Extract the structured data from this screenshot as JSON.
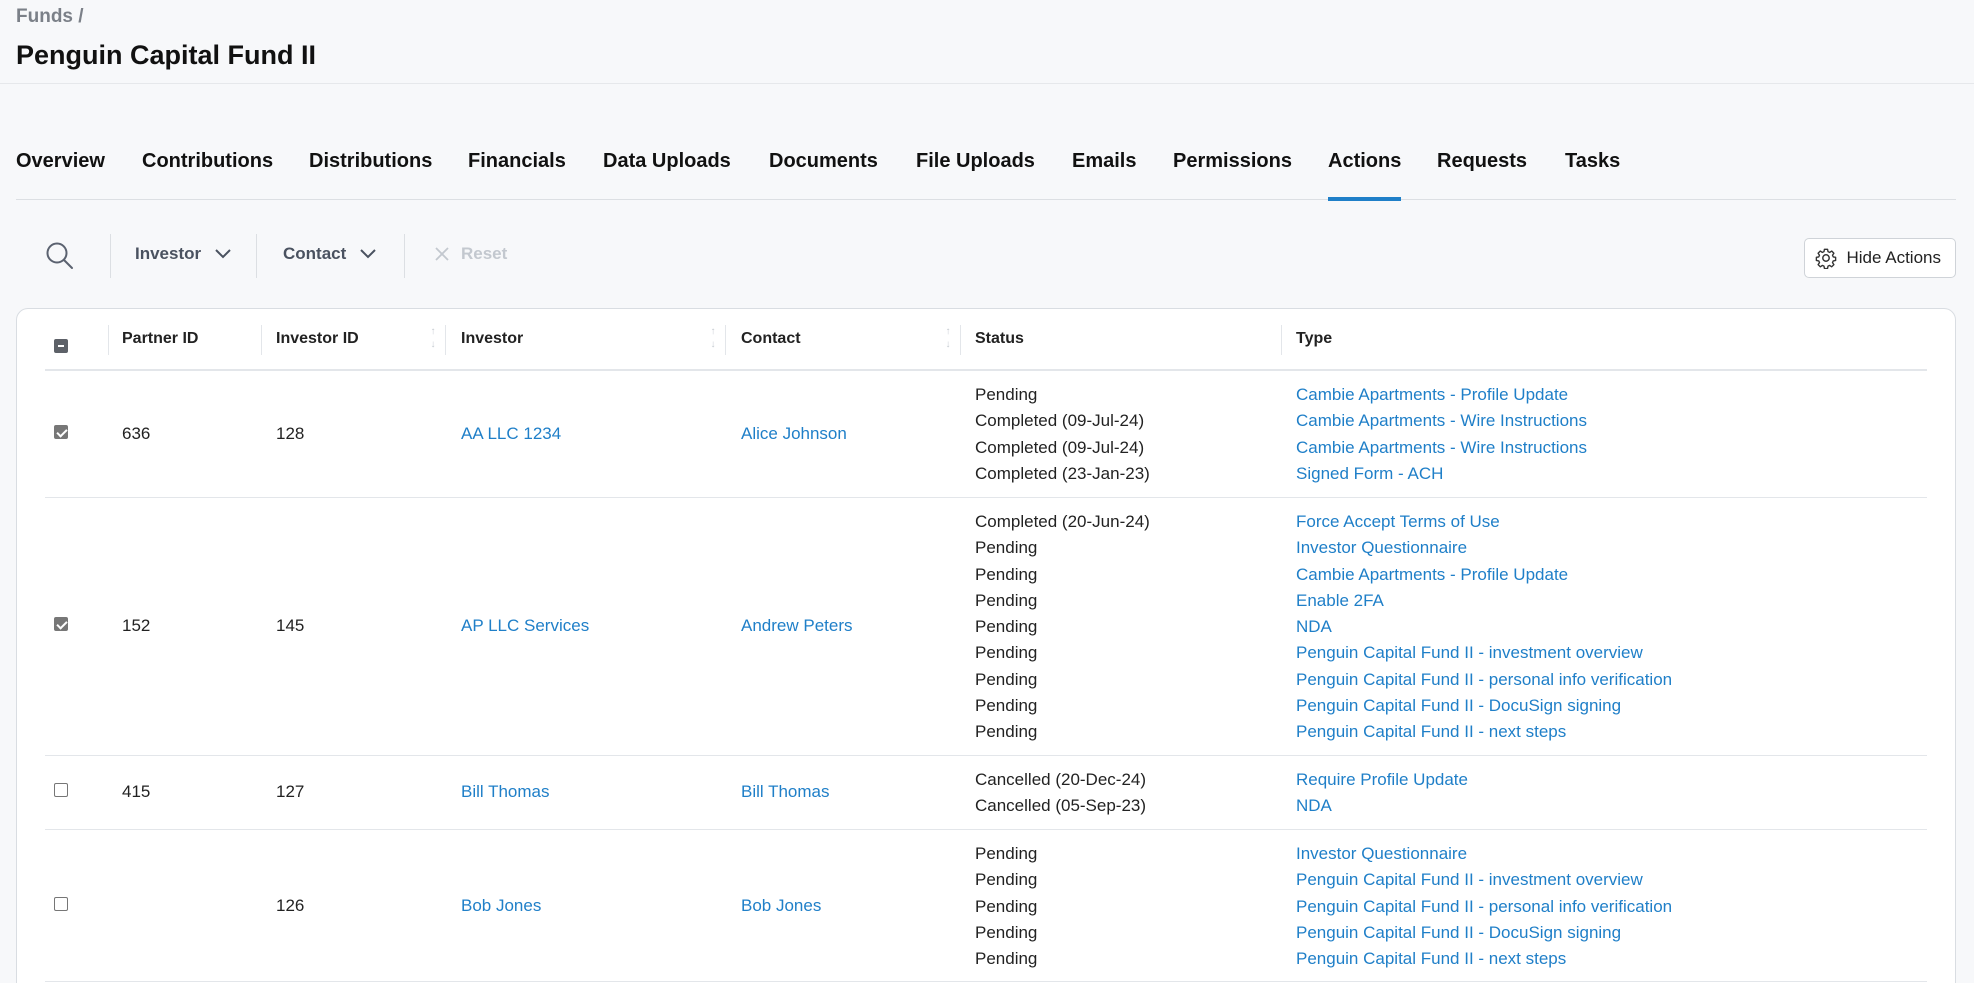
{
  "breadcrumb": "Funds /",
  "page_title": "Penguin Capital Fund II",
  "tabs": [
    {
      "label": "Overview"
    },
    {
      "label": "Contributions"
    },
    {
      "label": "Distributions"
    },
    {
      "label": "Financials"
    },
    {
      "label": "Data Uploads"
    },
    {
      "label": "Documents"
    },
    {
      "label": "File Uploads"
    },
    {
      "label": "Emails"
    },
    {
      "label": "Permissions"
    },
    {
      "label": "Actions"
    },
    {
      "label": "Requests"
    },
    {
      "label": "Tasks"
    }
  ],
  "active_tab": "Actions",
  "toolbar": {
    "icons": {
      "search": "search-icon",
      "chevron": "chevron-down-icon",
      "reset": "close-icon",
      "settings": "gear-icon"
    },
    "investor_filter": "Investor",
    "contact_filter": "Contact",
    "reset_label": "Reset",
    "hide_actions_label": "Hide Actions"
  },
  "table": {
    "headers": {
      "partner_id": "Partner ID",
      "investor_id": "Investor ID",
      "investor": "Investor",
      "contact": "Contact",
      "status": "Status",
      "type": "Type"
    },
    "select_all_state": "indeterminate",
    "rows": [
      {
        "checked": true,
        "partner_id": "636",
        "investor_id": "128",
        "investor": "AA LLC 1234",
        "contact": "Alice Johnson",
        "actions": [
          {
            "status": "Pending",
            "type": "Cambie Apartments - Profile Update"
          },
          {
            "status": "Completed (09-Jul-24)",
            "type": "Cambie Apartments - Wire Instructions"
          },
          {
            "status": "Completed (09-Jul-24)",
            "type": "Cambie Apartments - Wire Instructions"
          },
          {
            "status": "Completed (23-Jan-23)",
            "type": "Signed Form - ACH"
          }
        ]
      },
      {
        "checked": true,
        "partner_id": "152",
        "investor_id": "145",
        "investor": "AP LLC Services",
        "contact": "Andrew Peters",
        "actions": [
          {
            "status": "Completed (20-Jun-24)",
            "type": "Force Accept Terms of Use"
          },
          {
            "status": "Pending",
            "type": "Investor Questionnaire"
          },
          {
            "status": "Pending",
            "type": "Cambie Apartments - Profile Update"
          },
          {
            "status": "Pending",
            "type": "Enable 2FA"
          },
          {
            "status": "Pending",
            "type": "NDA"
          },
          {
            "status": "Pending",
            "type": "Penguin Capital Fund II - investment overview"
          },
          {
            "status": "Pending",
            "type": "Penguin Capital Fund II - personal info verification"
          },
          {
            "status": "Pending",
            "type": "Penguin Capital Fund II - DocuSign signing"
          },
          {
            "status": "Pending",
            "type": "Penguin Capital Fund II - next steps"
          }
        ]
      },
      {
        "checked": false,
        "partner_id": "415",
        "investor_id": "127",
        "investor": "Bill Thomas",
        "contact": "Bill Thomas",
        "actions": [
          {
            "status": "Cancelled (20-Dec-24)",
            "type": "Require Profile Update"
          },
          {
            "status": "Cancelled (05-Sep-23)",
            "type": "NDA"
          }
        ]
      },
      {
        "checked": false,
        "partner_id": "",
        "investor_id": "126",
        "investor": "Bob Jones",
        "contact": "Bob Jones",
        "actions": [
          {
            "status": "Pending",
            "type": "Investor Questionnaire"
          },
          {
            "status": "Pending",
            "type": "Penguin Capital Fund II - investment overview"
          },
          {
            "status": "Pending",
            "type": "Penguin Capital Fund II - personal info verification"
          },
          {
            "status": "Pending",
            "type": "Penguin Capital Fund II - DocuSign signing"
          },
          {
            "status": "Pending",
            "type": "Penguin Capital Fund II - next steps"
          }
        ]
      }
    ]
  },
  "colors": {
    "accent": "#1f7fc8",
    "link": "#1f7fc8",
    "muted": "#7b8088"
  }
}
